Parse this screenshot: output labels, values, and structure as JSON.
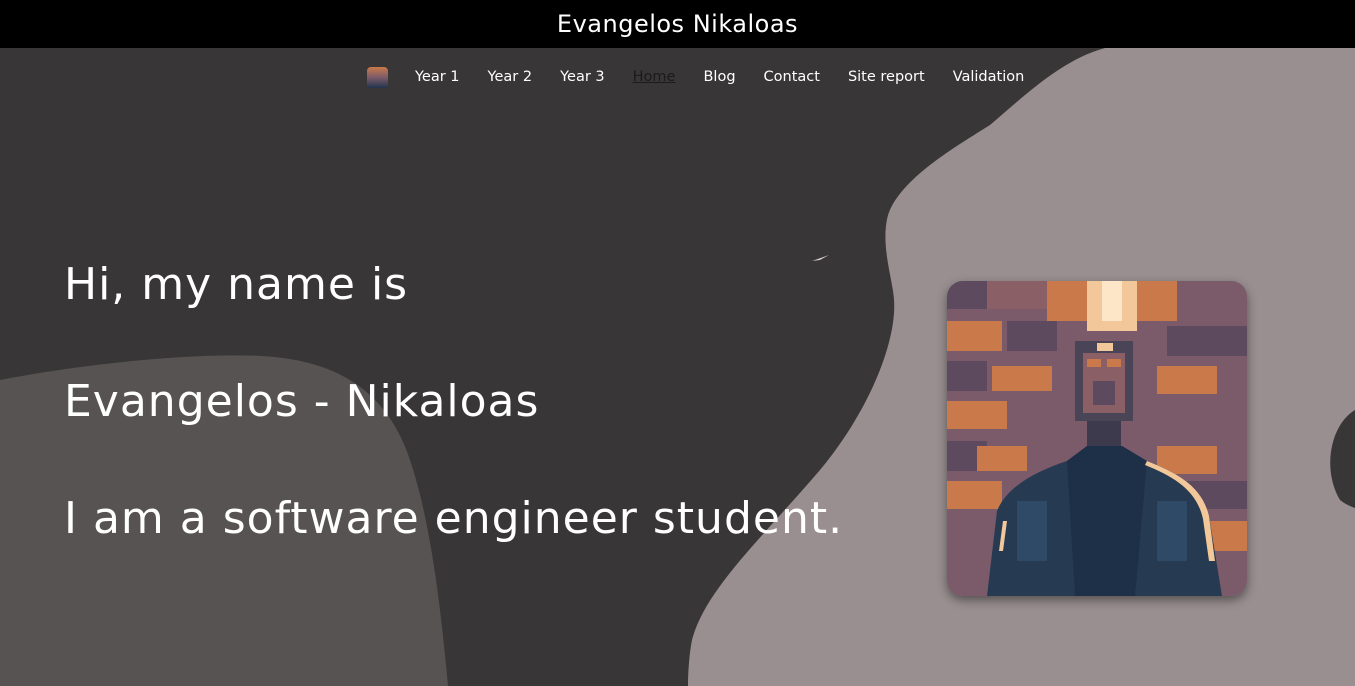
{
  "header": {
    "title": "Evangelos Nikaloas"
  },
  "nav": {
    "items": [
      {
        "label": "Year 1",
        "active": false
      },
      {
        "label": "Year 2",
        "active": false
      },
      {
        "label": "Year 3",
        "active": false
      },
      {
        "label": "Home",
        "active": true
      },
      {
        "label": "Blog",
        "active": false
      },
      {
        "label": "Contact",
        "active": false
      },
      {
        "label": "Site report",
        "active": false
      },
      {
        "label": "Validation",
        "active": false
      }
    ]
  },
  "hero": {
    "line1": "Hi, my name is",
    "line2": "Evangelos - Nikaloas",
    "line3": "I am a software engineer student."
  },
  "colors": {
    "background": "#383637",
    "blob_light": "#998f90",
    "blob_mid": "#575352",
    "header_bg": "#000000",
    "text": "#ffffff",
    "active_link": "#1b1b1b"
  }
}
